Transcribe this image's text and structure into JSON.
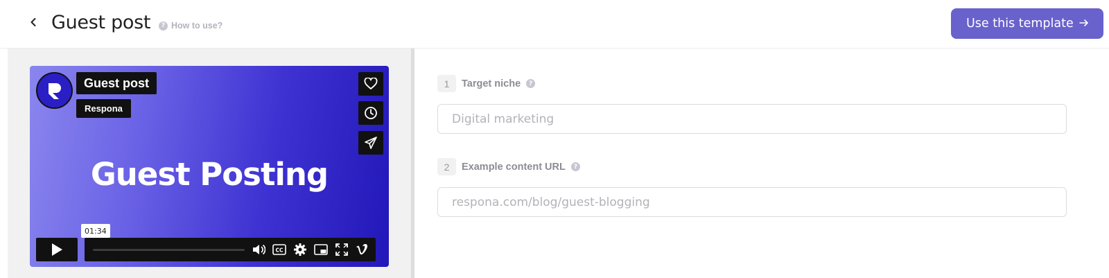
{
  "header": {
    "title": "Guest post",
    "help_link": "How to use?",
    "cta_label": "Use this template"
  },
  "video": {
    "title": "Guest post",
    "author": "Respona",
    "headline": "Guest Posting",
    "timestamp": "01:34",
    "progress": 0.0
  },
  "form": {
    "fields": [
      {
        "number": "1",
        "label": "Target niche",
        "placeholder": "Digital marketing"
      },
      {
        "number": "2",
        "label": "Example content URL",
        "placeholder": "respona.com/blog/guest-blogging"
      }
    ]
  },
  "colors": {
    "accent": "#6961cc",
    "video_gradient_start": "#8a86ee",
    "video_gradient_end": "#2217b8"
  },
  "icons": [
    "chevron-left-icon",
    "question-icon",
    "arrow-right-icon",
    "heart-icon",
    "clock-icon",
    "send-icon",
    "play-icon",
    "volume-icon",
    "cc-icon",
    "gear-icon",
    "pip-icon",
    "fullscreen-icon",
    "vimeo-icon"
  ]
}
